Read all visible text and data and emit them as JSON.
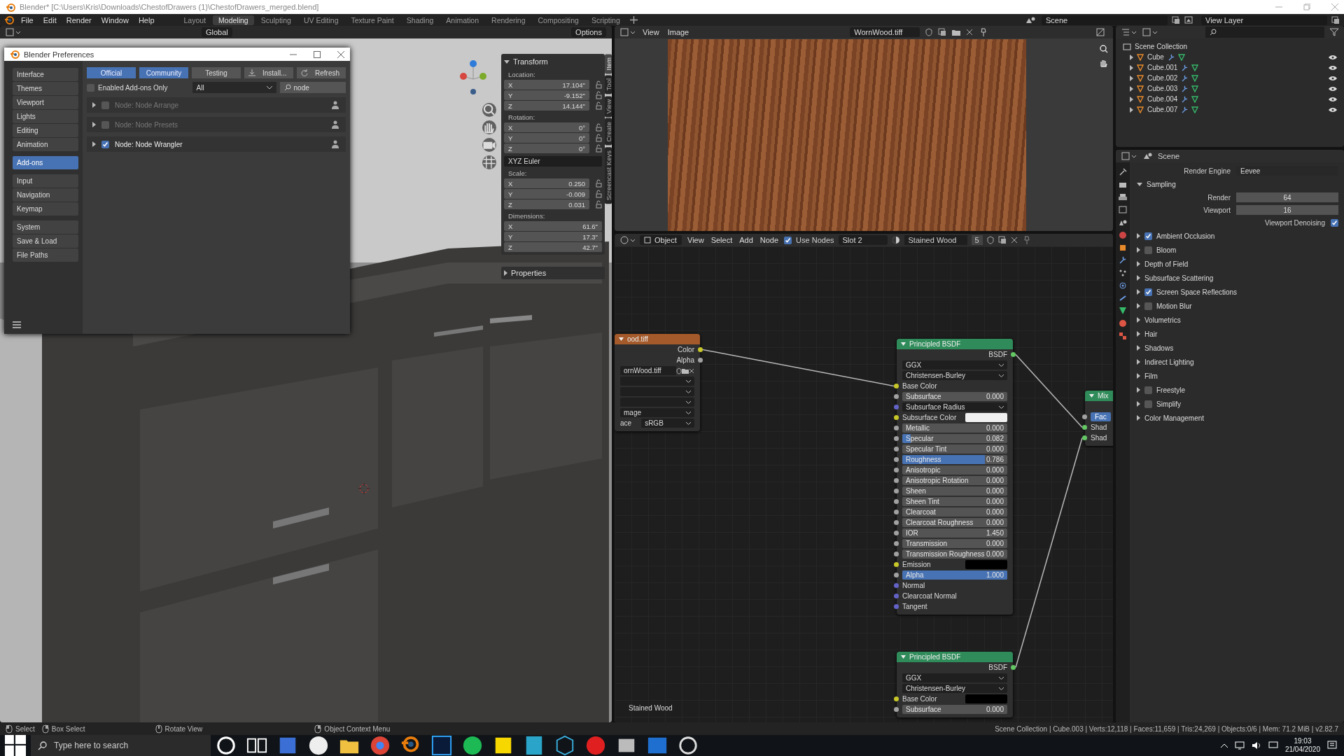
{
  "window": {
    "title": "Blender* [C:\\Users\\Kris\\Downloads\\ChestofDrawers (1)\\ChestofDrawers_merged.blend]"
  },
  "menu": [
    "File",
    "Edit",
    "Render",
    "Window",
    "Help"
  ],
  "workspaces": [
    {
      "label": "Layout",
      "selected": false
    },
    {
      "label": "Modeling",
      "selected": true
    },
    {
      "label": "Sculpting",
      "selected": false
    },
    {
      "label": "UV Editing",
      "selected": false
    },
    {
      "label": "Texture Paint",
      "selected": false
    },
    {
      "label": "Shading",
      "selected": false
    },
    {
      "label": "Animation",
      "selected": false
    },
    {
      "label": "Rendering",
      "selected": false
    },
    {
      "label": "Compositing",
      "selected": false
    },
    {
      "label": "Scripting",
      "selected": false
    }
  ],
  "scene": "Scene",
  "view_layer": "View Layer",
  "viewport": {
    "orientation": "Global",
    "options": "Options",
    "sidebar_tabs": [
      {
        "label": "Item",
        "selected": true
      },
      {
        "label": "Tool",
        "selected": false
      },
      {
        "label": "View",
        "selected": false
      },
      {
        "label": "Create",
        "selected": false
      },
      {
        "label": "Screencast Keys",
        "selected": false
      }
    ],
    "transform": {
      "title": "Transform",
      "expanded": true,
      "groups": [
        {
          "kind": "vector",
          "label": "Location:",
          "locks": true,
          "fields": [
            {
              "axis": "X",
              "value": "17.104\""
            },
            {
              "axis": "Y",
              "value": "-9.152\""
            },
            {
              "axis": "Z",
              "value": "14.144\""
            }
          ]
        },
        {
          "kind": "vector",
          "label": "Rotation:",
          "locks": true,
          "fields": [
            {
              "axis": "X",
              "value": "0°"
            },
            {
              "axis": "Y",
              "value": "0°"
            },
            {
              "axis": "Z",
              "value": "0°"
            }
          ]
        },
        {
          "kind": "enum",
          "value": "XYZ Euler"
        },
        {
          "kind": "vector",
          "label": "Scale:",
          "locks": true,
          "fields": [
            {
              "axis": "X",
              "value": "0.250"
            },
            {
              "axis": "Y",
              "value": "-0.009"
            },
            {
              "axis": "Z",
              "value": "0.031"
            }
          ]
        },
        {
          "kind": "vector",
          "label": "Dimensions:",
          "locks": false,
          "fields": [
            {
              "axis": "X",
              "value": "61.6\""
            },
            {
              "axis": "Y",
              "value": "17.3\""
            },
            {
              "axis": "Z",
              "value": "42.7\""
            }
          ]
        }
      ]
    },
    "properties_panel": {
      "title": "Properties",
      "expanded": false
    }
  },
  "preferences": {
    "title": "Blender Preferences",
    "nav_groups": [
      [
        {
          "label": "Interface",
          "selected": false
        },
        {
          "label": "Themes",
          "selected": false
        },
        {
          "label": "Viewport",
          "selected": false
        },
        {
          "label": "Lights",
          "selected": false
        },
        {
          "label": "Editing",
          "selected": false
        },
        {
          "label": "Animation",
          "selected": false
        }
      ],
      [
        {
          "label": "Add-ons",
          "selected": true
        }
      ],
      [
        {
          "label": "Input",
          "selected": false
        },
        {
          "label": "Navigation",
          "selected": false
        },
        {
          "label": "Keymap",
          "selected": false
        }
      ],
      [
        {
          "label": "System",
          "selected": false
        },
        {
          "label": "Save & Load",
          "selected": false
        },
        {
          "label": "File Paths",
          "selected": false
        }
      ]
    ],
    "support_tabs": [
      {
        "label": "Official",
        "selected": true
      },
      {
        "label": "Community",
        "selected": true
      },
      {
        "label": "Testing",
        "selected": false
      }
    ],
    "actions": [
      {
        "kind": "install",
        "label": "Install..."
      },
      {
        "kind": "refresh",
        "label": "Refresh"
      }
    ],
    "enabled_only": {
      "label": "Enabled Add-ons Only",
      "checked": false
    },
    "category": "All",
    "search": "node",
    "addons": [
      {
        "name": "Node: Node Arrange",
        "checked": false,
        "expanded": false
      },
      {
        "name": "Node: Node Presets",
        "checked": false,
        "expanded": false
      },
      {
        "name": "Node: Node Wrangler",
        "checked": true,
        "expanded": false
      }
    ]
  },
  "image_editor": {
    "menu": [
      "View",
      "Image"
    ],
    "image": "WornWood.tiff"
  },
  "node_editor": {
    "object_mode": "Object",
    "menu": [
      "View",
      "Select",
      "Add",
      "Node"
    ],
    "use_nodes": {
      "label": "Use Nodes",
      "checked": true
    },
    "slot": "Slot 2",
    "material": "Stained Wood",
    "users": "5",
    "frame_label": "Stained Wood",
    "nodes": [
      {
        "kind": "image",
        "title": "ood.tiff",
        "rows": [
          {
            "kind": "output",
            "label": "Color",
            "socket": {
              "color": "#c7c729"
            }
          },
          {
            "kind": "output",
            "label": "Alpha",
            "socket": {
              "color": "#a1a1a1"
            }
          },
          {
            "kind": "image_field",
            "value": "ornWood.tiff"
          },
          {
            "kind": "enum"
          },
          {
            "kind": "enum"
          },
          {
            "kind": "enum"
          },
          {
            "kind": "enum",
            "value": "mage"
          },
          {
            "kind": "labeled_enum",
            "label": "ace",
            "value": "sRGB"
          }
        ]
      },
      {
        "kind": "principled",
        "title": "Principled BSDF",
        "rows": [
          {
            "kind": "output",
            "label": "BSDF",
            "socket": {
              "color": "#63c763"
            }
          },
          {
            "kind": "enum",
            "value": "GGX"
          },
          {
            "kind": "enum",
            "value": "Christensen-Burley"
          },
          {
            "kind": "socket",
            "label": "Base Color",
            "socket": {
              "color": "#c7c729"
            }
          },
          {
            "kind": "slider",
            "label": "Subsurface",
            "value": "0.000",
            "level": 0,
            "socket": {
              "color": "#a1a1a1"
            }
          },
          {
            "kind": "socket_enum",
            "label": "Subsurface Radius",
            "socket": {
              "color": "#6363c7"
            }
          },
          {
            "kind": "color",
            "label": "Subsurface Color",
            "color": "#f0f0f0",
            "socket": {
              "color": "#c7c729"
            }
          },
          {
            "kind": "slider",
            "label": "Metallic",
            "value": "0.000",
            "level": 0,
            "socket": {
              "color": "#a1a1a1"
            }
          },
          {
            "kind": "slider",
            "label": "Specular",
            "value": "0.082",
            "level": 0.082,
            "socket": {
              "color": "#a1a1a1"
            }
          },
          {
            "kind": "slider",
            "label": "Specular Tint",
            "value": "0.000",
            "level": 0,
            "socket": {
              "color": "#a1a1a1"
            }
          },
          {
            "kind": "slider",
            "label": "Roughness",
            "value": "0.786",
            "level": 0.786,
            "socket": {
              "color": "#a1a1a1"
            }
          },
          {
            "kind": "slider",
            "label": "Anisotropic",
            "value": "0.000",
            "level": 0,
            "socket": {
              "color": "#a1a1a1"
            }
          },
          {
            "kind": "slider",
            "label": "Anisotropic Rotation",
            "value": "0.000",
            "level": 0,
            "socket": {
              "color": "#a1a1a1"
            }
          },
          {
            "kind": "slider",
            "label": "Sheen",
            "value": "0.000",
            "level": 0,
            "socket": {
              "color": "#a1a1a1"
            }
          },
          {
            "kind": "slider",
            "label": "Sheen Tint",
            "value": "0.000",
            "level": 0,
            "socket": {
              "color": "#a1a1a1"
            }
          },
          {
            "kind": "slider",
            "label": "Clearcoat",
            "value": "0.000",
            "level": 0,
            "socket": {
              "color": "#a1a1a1"
            }
          },
          {
            "kind": "slider",
            "label": "Clearcoat Roughness",
            "value": "0.000",
            "level": 0,
            "socket": {
              "color": "#a1a1a1"
            }
          },
          {
            "kind": "number",
            "label": "IOR",
            "value": "1.450",
            "socket": {
              "color": "#a1a1a1"
            }
          },
          {
            "kind": "slider",
            "label": "Transmission",
            "value": "0.000",
            "level": 0,
            "socket": {
              "color": "#a1a1a1"
            }
          },
          {
            "kind": "slider",
            "label": "Transmission Roughness",
            "value": "0.000",
            "level": 0,
            "socket": {
              "color": "#a1a1a1"
            }
          },
          {
            "kind": "color",
            "label": "Emission",
            "color": "#000000",
            "socket": {
              "color": "#c7c729"
            }
          },
          {
            "kind": "slider",
            "label": "Alpha",
            "value": "1.000",
            "level": 1,
            "socket": {
              "color": "#a1a1a1"
            }
          },
          {
            "kind": "socket",
            "label": "Normal",
            "socket": {
              "color": "#6363c7"
            }
          },
          {
            "kind": "socket",
            "label": "Clearcoat Normal",
            "socket": {
              "color": "#6363c7"
            }
          },
          {
            "kind": "socket",
            "label": "Tangent",
            "socket": {
              "color": "#6363c7"
            }
          }
        ]
      },
      {
        "kind": "principled",
        "title": "Principled BSDF",
        "rows": [
          {
            "kind": "output",
            "label": "BSDF",
            "socket": {
              "color": "#63c763"
            }
          },
          {
            "kind": "enum",
            "value": "GGX"
          },
          {
            "kind": "enum",
            "value": "Christensen-Burley"
          },
          {
            "kind": "color",
            "label": "Base Color",
            "color": "#000000",
            "socket": {
              "color": "#c7c729"
            }
          },
          {
            "kind": "slider",
            "label": "Subsurface",
            "value": "0.000",
            "level": 0,
            "socket": {
              "color": "#a1a1a1"
            }
          }
        ]
      },
      {
        "kind": "mix",
        "title": "Mix",
        "rows": [
          {
            "kind": "blank"
          },
          {
            "kind": "field",
            "label": "Fac",
            "socket": {
              "color": "#a1a1a1"
            }
          },
          {
            "kind": "socket",
            "label": "Shad",
            "socket": {
              "color": "#63c763"
            }
          },
          {
            "kind": "socket",
            "label": "Shad",
            "socket": {
              "color": "#63c763"
            }
          }
        ]
      }
    ]
  },
  "outliner": {
    "tree": {
      "name": "Scene Collection",
      "children": [
        {
          "name": "Cube",
          "expanded": false
        },
        {
          "name": "Cube.001",
          "expanded": false
        },
        {
          "name": "Cube.002",
          "expanded": false
        },
        {
          "name": "Cube.003",
          "expanded": false
        },
        {
          "name": "Cube.004",
          "expanded": false
        },
        {
          "name": "Cube.007",
          "expanded": false
        }
      ]
    }
  },
  "properties": {
    "context": "Scene",
    "render_engine": {
      "label": "Render Engine",
      "value": "Eevee"
    },
    "sampling": {
      "title": "Sampling",
      "expanded": true,
      "fields": [
        {
          "label": "Render",
          "value": "64"
        },
        {
          "label": "Viewport",
          "value": "16"
        }
      ],
      "denoising": {
        "label": "Viewport Denoising",
        "checked": true
      }
    },
    "panels": [
      {
        "kind": "toggle",
        "title": "Ambient Occlusion",
        "checked": true,
        "expanded": false
      },
      {
        "kind": "toggle",
        "title": "Bloom",
        "checked": false,
        "expanded": false
      },
      {
        "kind": "plain",
        "title": "Depth of Field",
        "expanded": false
      },
      {
        "kind": "plain",
        "title": "Subsurface Scattering",
        "expanded": false
      },
      {
        "kind": "toggle",
        "title": "Screen Space Reflections",
        "checked": true,
        "expanded": false
      },
      {
        "kind": "toggle",
        "title": "Motion Blur",
        "checked": false,
        "expanded": false
      },
      {
        "kind": "plain",
        "title": "Volumetrics",
        "expanded": false
      },
      {
        "kind": "plain",
        "title": "Hair",
        "expanded": false
      },
      {
        "kind": "plain",
        "title": "Shadows",
        "expanded": false
      },
      {
        "kind": "plain",
        "title": "Indirect Lighting",
        "expanded": false
      },
      {
        "kind": "plain",
        "title": "Film",
        "expanded": false
      },
      {
        "kind": "toggle",
        "title": "Freestyle",
        "checked": false,
        "expanded": false
      },
      {
        "kind": "toggle",
        "title": "Simplify",
        "checked": false,
        "expanded": false
      },
      {
        "kind": "plain",
        "title": "Color Management",
        "expanded": false
      }
    ]
  },
  "status_bar": {
    "hints": [
      "Select",
      "Box Select",
      "Rotate View",
      "Object Context Menu"
    ],
    "stats": "Scene Collection | Cube.003 | Verts:12,118 | Faces:11,659 | Tris:24,269 | Objects:0/6 | Mem: 71.2 MiB | v2.82.7"
  },
  "taskbar": {
    "search_placeholder": "Type here to search",
    "time": "19:03",
    "date": "21/04/2020"
  }
}
